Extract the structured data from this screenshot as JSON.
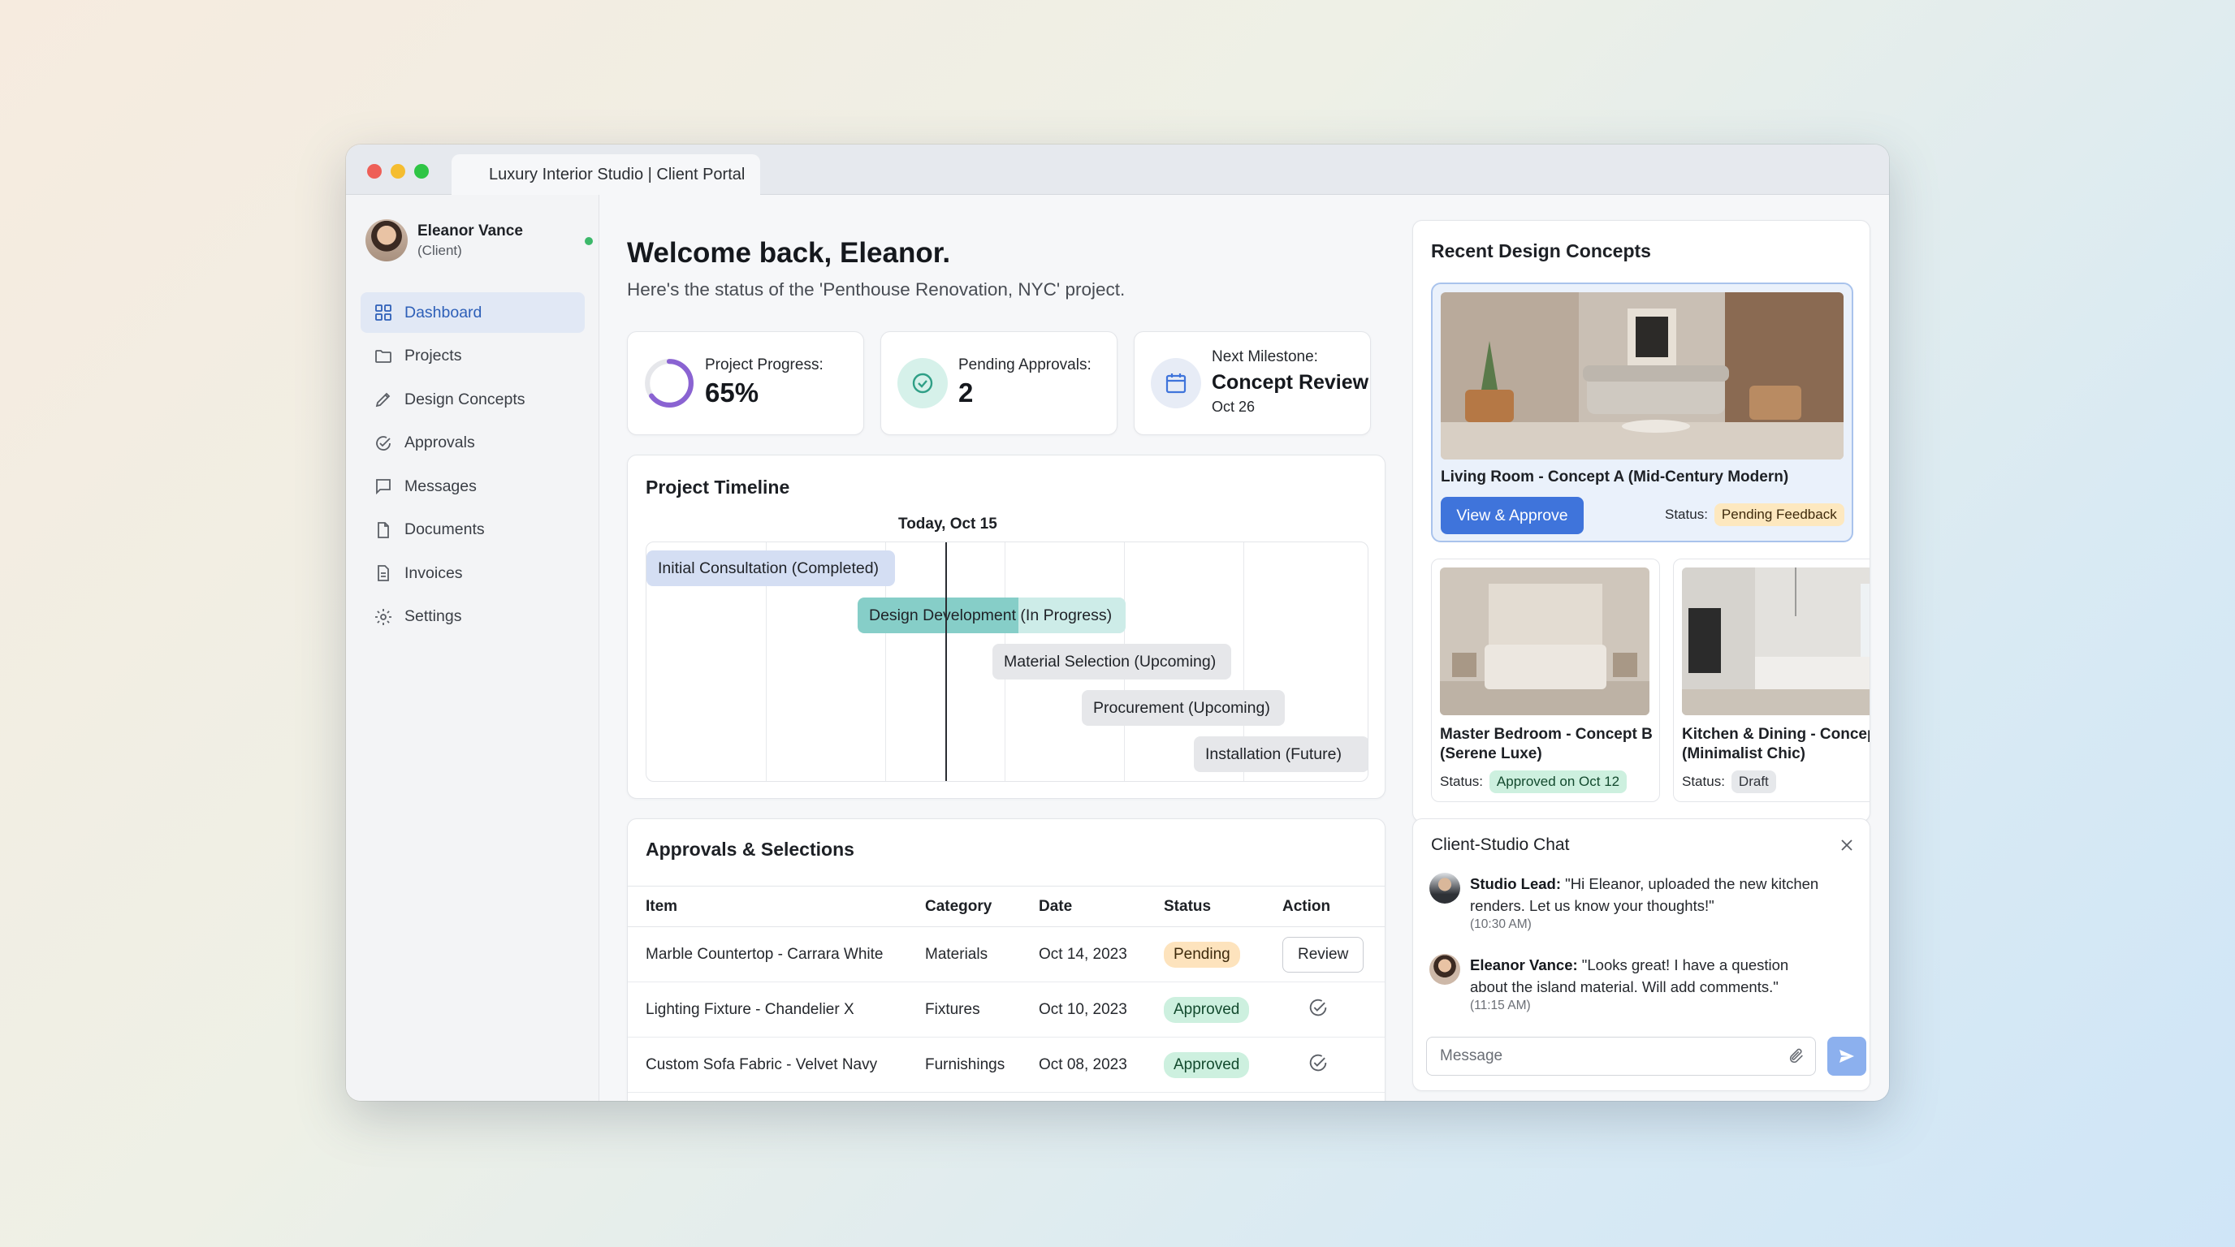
{
  "window": {
    "tab_title": "Luxury Interior Studio | Client Portal"
  },
  "user": {
    "name": "Eleanor Vance",
    "role": "(Client)"
  },
  "sidebar": {
    "items": [
      {
        "label": "Dashboard",
        "icon": "dashboard-grid-icon",
        "active": true
      },
      {
        "label": "Projects",
        "icon": "folder-icon"
      },
      {
        "label": "Design Concepts",
        "icon": "pen-icon"
      },
      {
        "label": "Approvals",
        "icon": "check-circle-icon"
      },
      {
        "label": "Messages",
        "icon": "message-icon"
      },
      {
        "label": "Documents",
        "icon": "document-icon"
      },
      {
        "label": "Invoices",
        "icon": "invoice-icon"
      },
      {
        "label": "Settings",
        "icon": "gear-icon"
      }
    ]
  },
  "header": {
    "welcome": "Welcome back, Eleanor.",
    "subtitle": "Here's the status of the 'Penthouse Renovation, NYC' project."
  },
  "stats": {
    "progress": {
      "label": "Project Progress:",
      "value": "65%",
      "fraction": 0.65
    },
    "pending": {
      "label": "Pending Approvals:",
      "value": "2"
    },
    "milestone": {
      "label": "Next Milestone:",
      "value": "Concept Review",
      "date": "Oct 26"
    }
  },
  "timeline": {
    "title": "Project Timeline",
    "today_label": "Today, Oct 15",
    "phases": [
      {
        "label": "Initial Consultation (Completed)",
        "state": "completed"
      },
      {
        "label": "Design Development (In Progress)",
        "state": "in-progress",
        "progress": 0.6
      },
      {
        "label": "Material Selection (Upcoming)",
        "state": "upcoming"
      },
      {
        "label": "Procurement (Upcoming)",
        "state": "upcoming"
      },
      {
        "label": "Installation (Future)",
        "state": "future"
      }
    ]
  },
  "approvals": {
    "title": "Approvals & Selections",
    "columns": [
      "Item",
      "Category",
      "Date",
      "Status",
      "Action"
    ],
    "rows": [
      {
        "item": "Marble Countertop - Carrara White",
        "category": "Materials",
        "date": "Oct 14, 2023",
        "status": "Pending",
        "action": "Review"
      },
      {
        "item": "Lighting Fixture - Chandelier X",
        "category": "Fixtures",
        "date": "Oct 10, 2023",
        "status": "Approved",
        "action": ""
      },
      {
        "item": "Custom Sofa Fabric - Velvet Navy",
        "category": "Furnishings",
        "date": "Oct 08, 2023",
        "status": "Approved",
        "action": ""
      }
    ]
  },
  "concepts": {
    "title": "Recent Design Concepts",
    "featured": {
      "name": "Living Room - Concept A (Mid-Century Modern)",
      "button": "View & Approve",
      "status_label": "Status:",
      "status": "Pending Feedback"
    },
    "items": [
      {
        "name": "Master Bedroom - Concept B (Serene Luxe)",
        "status_label": "Status:",
        "status": "Approved on Oct 12"
      },
      {
        "name": "Kitchen & Dining - Concept (Minimalist Chic)",
        "status_label": "Status:",
        "status": "Draft"
      }
    ]
  },
  "chat": {
    "title": "Client-Studio Chat",
    "messages": [
      {
        "sender": "Studio Lead:",
        "text": "\"Hi Eleanor, uploaded the new kitchen renders. Let us know your thoughts!\"",
        "time": "(10:30 AM)"
      },
      {
        "sender": "Eleanor Vance:",
        "text": "\"Looks great! I have a question about the island material. Will add comments.\"",
        "time": "(11:15 AM)"
      }
    ],
    "input_placeholder": "Message"
  },
  "colors": {
    "accent": "#3f74db",
    "progress_ring": "#8a63d2",
    "timeline_fill": "#86cec8",
    "online": "#3cb86a"
  }
}
